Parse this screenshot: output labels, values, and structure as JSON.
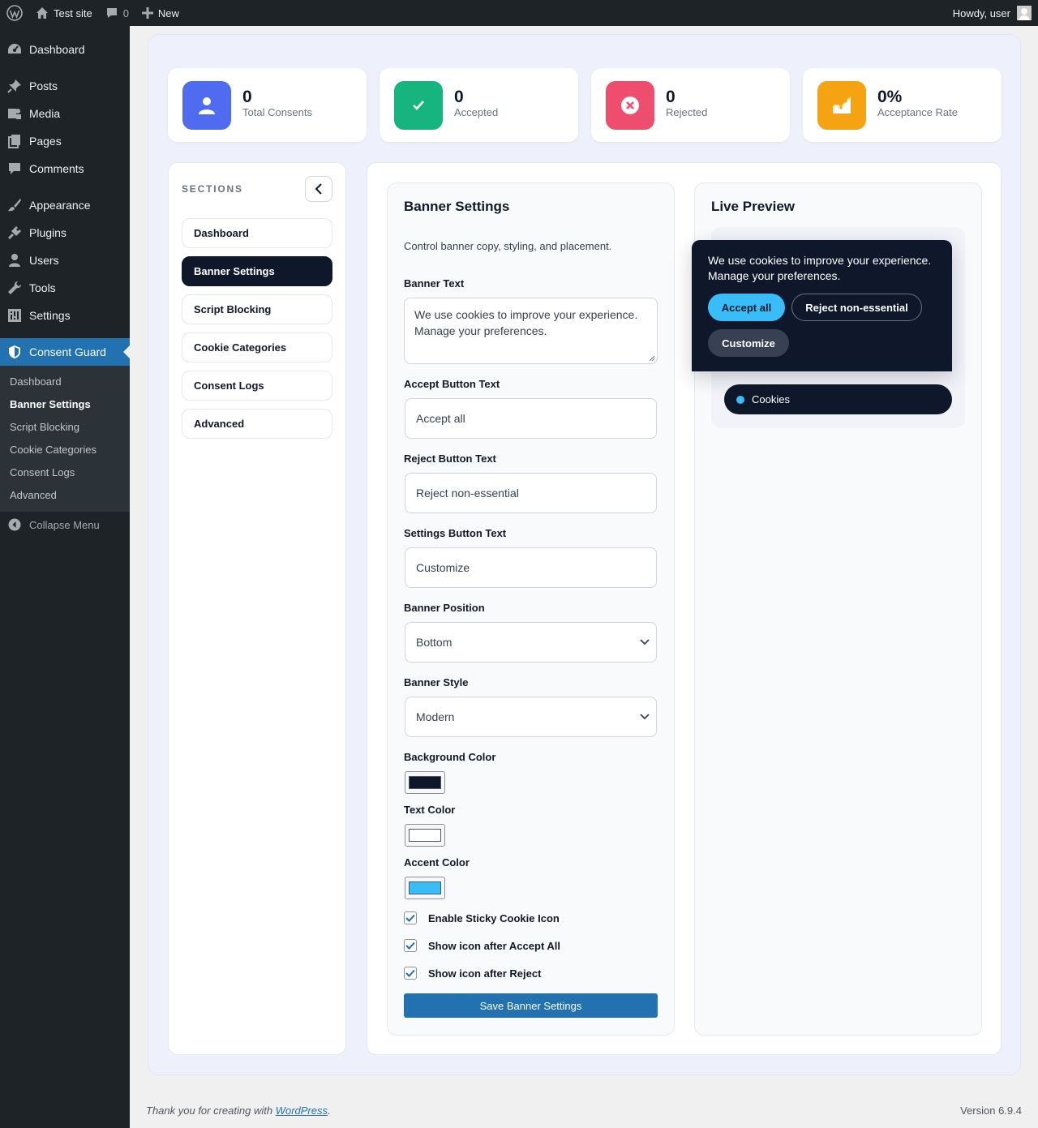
{
  "adminbar": {
    "site_name": "Test site",
    "comments_count": "0",
    "new_label": "New",
    "howdy": "Howdy, user"
  },
  "sidebar": {
    "items": [
      {
        "label": "Dashboard",
        "icon": "dashboard-icon"
      },
      {
        "label": "Posts",
        "icon": "pin-icon"
      },
      {
        "label": "Media",
        "icon": "media-icon"
      },
      {
        "label": "Pages",
        "icon": "pages-icon"
      },
      {
        "label": "Comments",
        "icon": "comment-icon"
      },
      {
        "label": "Appearance",
        "icon": "brush-icon"
      },
      {
        "label": "Plugins",
        "icon": "plug-icon"
      },
      {
        "label": "Users",
        "icon": "user-icon"
      },
      {
        "label": "Tools",
        "icon": "wrench-icon"
      },
      {
        "label": "Settings",
        "icon": "settings-icon"
      },
      {
        "label": "Consent Guard",
        "icon": "shield-icon"
      }
    ],
    "submenu": [
      "Dashboard",
      "Banner Settings",
      "Script Blocking",
      "Cookie Categories",
      "Consent Logs",
      "Advanced"
    ],
    "submenu_current": "Banner Settings",
    "collapse_label": "Collapse Menu"
  },
  "stats": [
    {
      "value": "0",
      "label": "Total Consents",
      "color": "#4f6cf0",
      "icon": "person-icon"
    },
    {
      "value": "0",
      "label": "Accepted",
      "color": "#16b47e",
      "icon": "check-icon"
    },
    {
      "value": "0",
      "label": "Rejected",
      "color": "#ee4d6e",
      "icon": "x-circle-icon"
    },
    {
      "value": "0%",
      "label": "Acceptance Rate",
      "color": "#f6a313",
      "icon": "chart-icon"
    }
  ],
  "sections": {
    "title": "SECTIONS",
    "items": [
      "Dashboard",
      "Banner Settings",
      "Script Blocking",
      "Cookie Categories",
      "Consent Logs",
      "Advanced"
    ],
    "active": "Banner Settings"
  },
  "banner_settings": {
    "title": "Banner Settings",
    "description": "Control banner copy, styling, and placement.",
    "banner_text_label": "Banner Text",
    "banner_text_value": "We use cookies to improve your experience. Manage your preferences.",
    "accept_label": "Accept Button Text",
    "accept_value": "Accept all",
    "reject_label": "Reject Button Text",
    "reject_value": "Reject non-essential",
    "settings_label": "Settings Button Text",
    "settings_value": "Customize",
    "position_label": "Banner Position",
    "position_value": "Bottom",
    "style_label": "Banner Style",
    "style_value": "Modern",
    "bg_color_label": "Background Color",
    "bg_color": "#0f172a",
    "text_color_label": "Text Color",
    "text_color": "#ffffff",
    "accent_color_label": "Accent Color",
    "accent_color": "#38bdf8",
    "checkboxes": [
      {
        "label": "Enable Sticky Cookie Icon",
        "checked": true
      },
      {
        "label": "Show icon after Accept All",
        "checked": true
      },
      {
        "label": "Show icon after Reject",
        "checked": true
      }
    ],
    "save_label": "Save Banner Settings"
  },
  "preview": {
    "title": "Live Preview",
    "banner_text": "We use cookies to improve your experience. Manage your preferences.",
    "accept": "Accept all",
    "reject": "Reject non-essential",
    "customize": "Customize",
    "pill_label": "Cookies"
  },
  "footer": {
    "thanks_prefix": "Thank you for creating with ",
    "thanks_link": "WordPress",
    "thanks_suffix": ".",
    "version": "Version 6.9.4"
  }
}
